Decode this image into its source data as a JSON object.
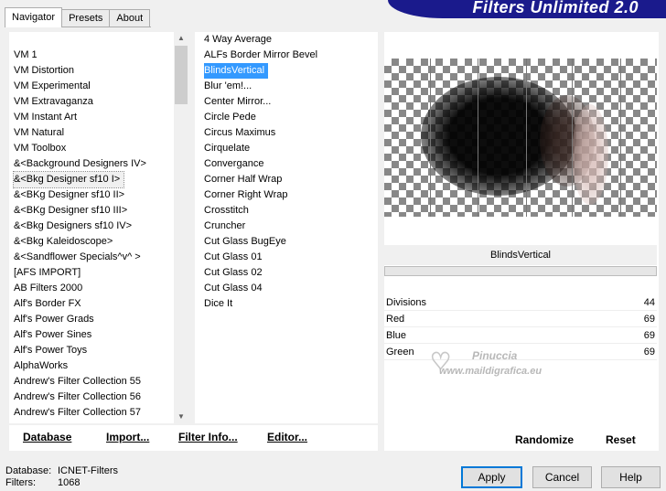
{
  "tabs": [
    "Navigator",
    "Presets",
    "About"
  ],
  "banner_title": "Filters Unlimited 2.0",
  "categories": [
    "VM 1",
    "VM Distortion",
    "VM Experimental",
    "VM Extravaganza",
    "VM Instant Art",
    "VM Natural",
    "VM Toolbox",
    "&<Background Designers IV>",
    "&<Bkg Designer sf10 I>",
    "&<BKg Designer sf10 II>",
    "&<BKg Designer sf10 III>",
    "&<Bkg Designers sf10 IV>",
    "&<Bkg Kaleidoscope>",
    "&<Sandflower Specials^v^ >",
    "[AFS IMPORT]",
    "AB Filters 2000",
    "Alf's Border FX",
    "Alf's Power Grads",
    "Alf's Power Sines",
    "Alf's Power Toys",
    "AlphaWorks",
    "Andrew's Filter Collection 55",
    "Andrew's Filter Collection 56",
    "Andrew's Filter Collection 57"
  ],
  "selected_category": "&<Bkg Designer sf10 I>",
  "filters": [
    "4 Way Average",
    "ALFs Border Mirror Bevel",
    "BlindsVertical",
    "Blur 'em!...",
    "Center Mirror...",
    "Circle Pede",
    "Circus Maximus",
    "Cirquelate",
    "Convergance",
    "Corner Half Wrap",
    "Corner Right Wrap",
    "Crosstitch",
    "Cruncher",
    "Cut Glass  BugEye",
    "Cut Glass 01",
    "Cut Glass 02",
    "Cut Glass 04",
    "Dice It"
  ],
  "selected_filter": "BlindsVertical",
  "left_buttons": {
    "database": "Database",
    "import": "Import...",
    "filter_info": "Filter Info...",
    "editor": "Editor..."
  },
  "filter_name": "BlindsVertical",
  "params": [
    {
      "label": "Divisions",
      "value": "44"
    },
    {
      "label": "Red",
      "value": "69"
    },
    {
      "label": "Blue",
      "value": "69"
    },
    {
      "label": "Green",
      "value": "69"
    }
  ],
  "watermark": {
    "line1": "Pinuccia",
    "line2": "www.maildigrafica.eu"
  },
  "right_buttons": {
    "randomize": "Randomize",
    "reset": "Reset"
  },
  "status": {
    "database_label": "Database:",
    "database_value": "ICNET-Filters",
    "filters_label": "Filters:",
    "filters_value": "1068"
  },
  "dialog_buttons": {
    "apply": "Apply",
    "cancel": "Cancel",
    "help": "Help"
  },
  "colors": {
    "banner": "#1a1a8c",
    "selection": "#3399ff",
    "default_button_border": "#0078d7"
  }
}
